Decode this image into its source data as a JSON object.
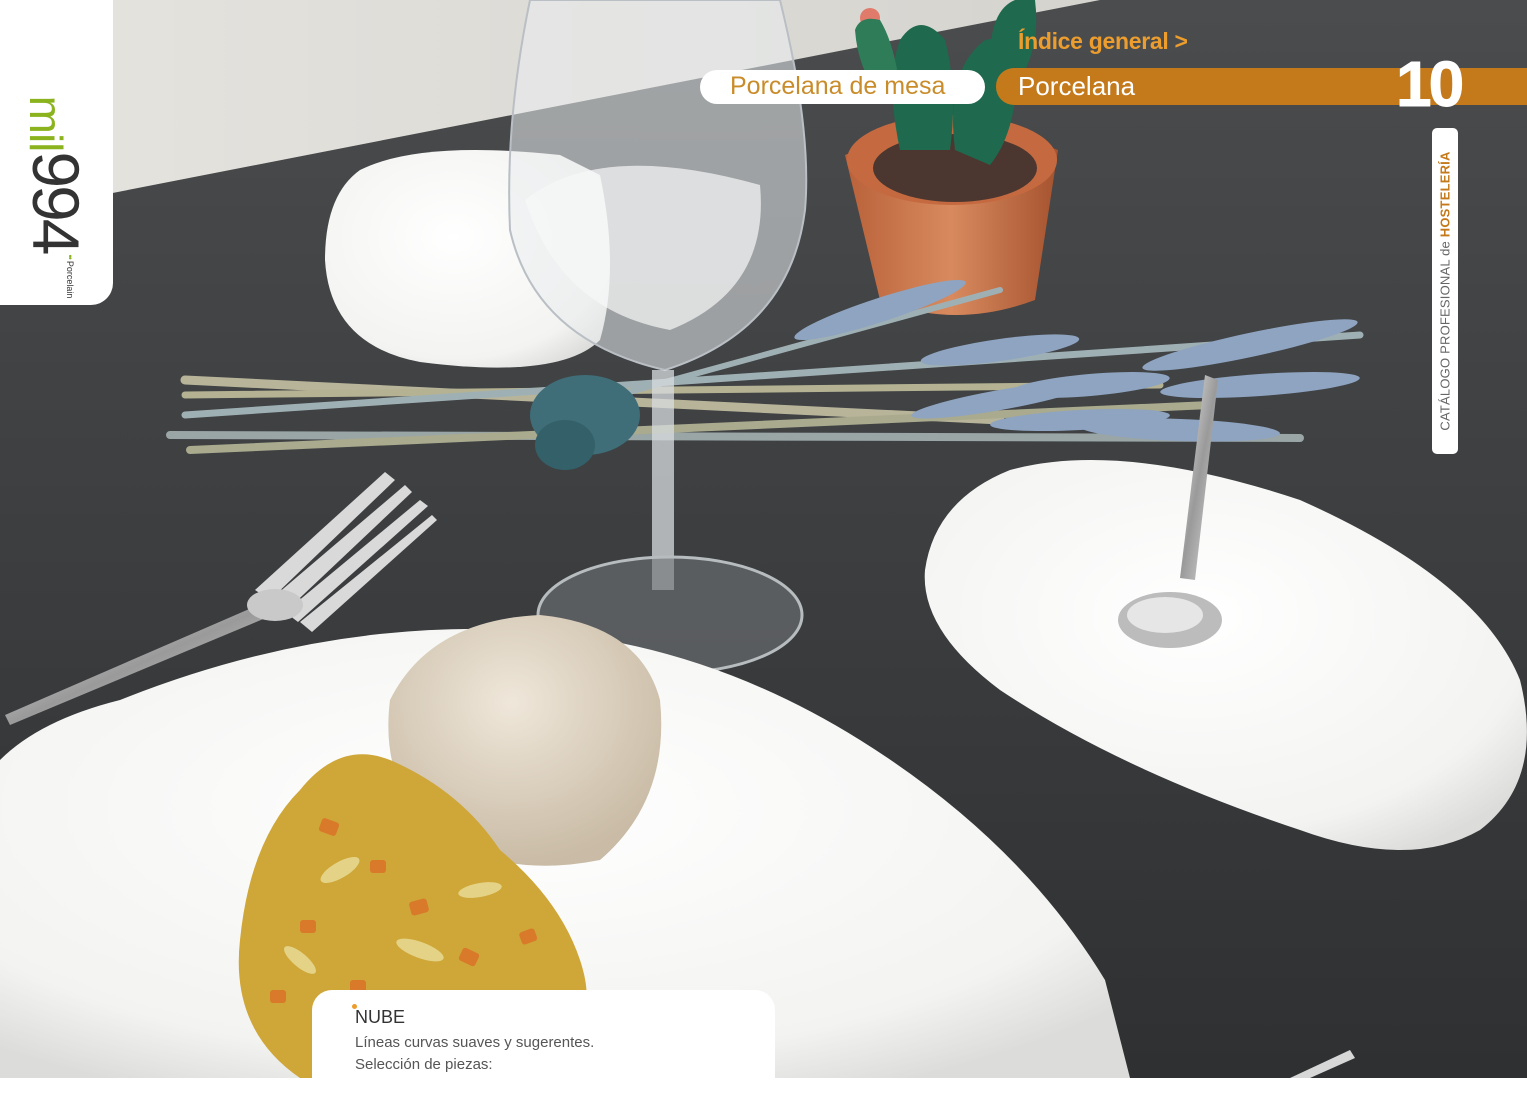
{
  "brand": {
    "logo_prefix": "mil",
    "logo_number": "994",
    "logo_dots": "••",
    "logo_subtitle": "Porcelain"
  },
  "navigation": {
    "index_link": "Índice general >",
    "breadcrumb": "Porcelana de mesa",
    "section": "Porcelana",
    "page_number": "10"
  },
  "side_tab": {
    "prefix": "CATÁLOGO PROFESIONAL de ",
    "emphasis": "HOSTELERÍA"
  },
  "product": {
    "name": "NUBE",
    "description": "Líneas curvas suaves y sugerentes.",
    "selection_label": "Selección de piezas:"
  },
  "colors": {
    "accent_orange": "#c4791a",
    "link_orange": "#ec9d2d",
    "brand_green": "#8ab31e"
  }
}
